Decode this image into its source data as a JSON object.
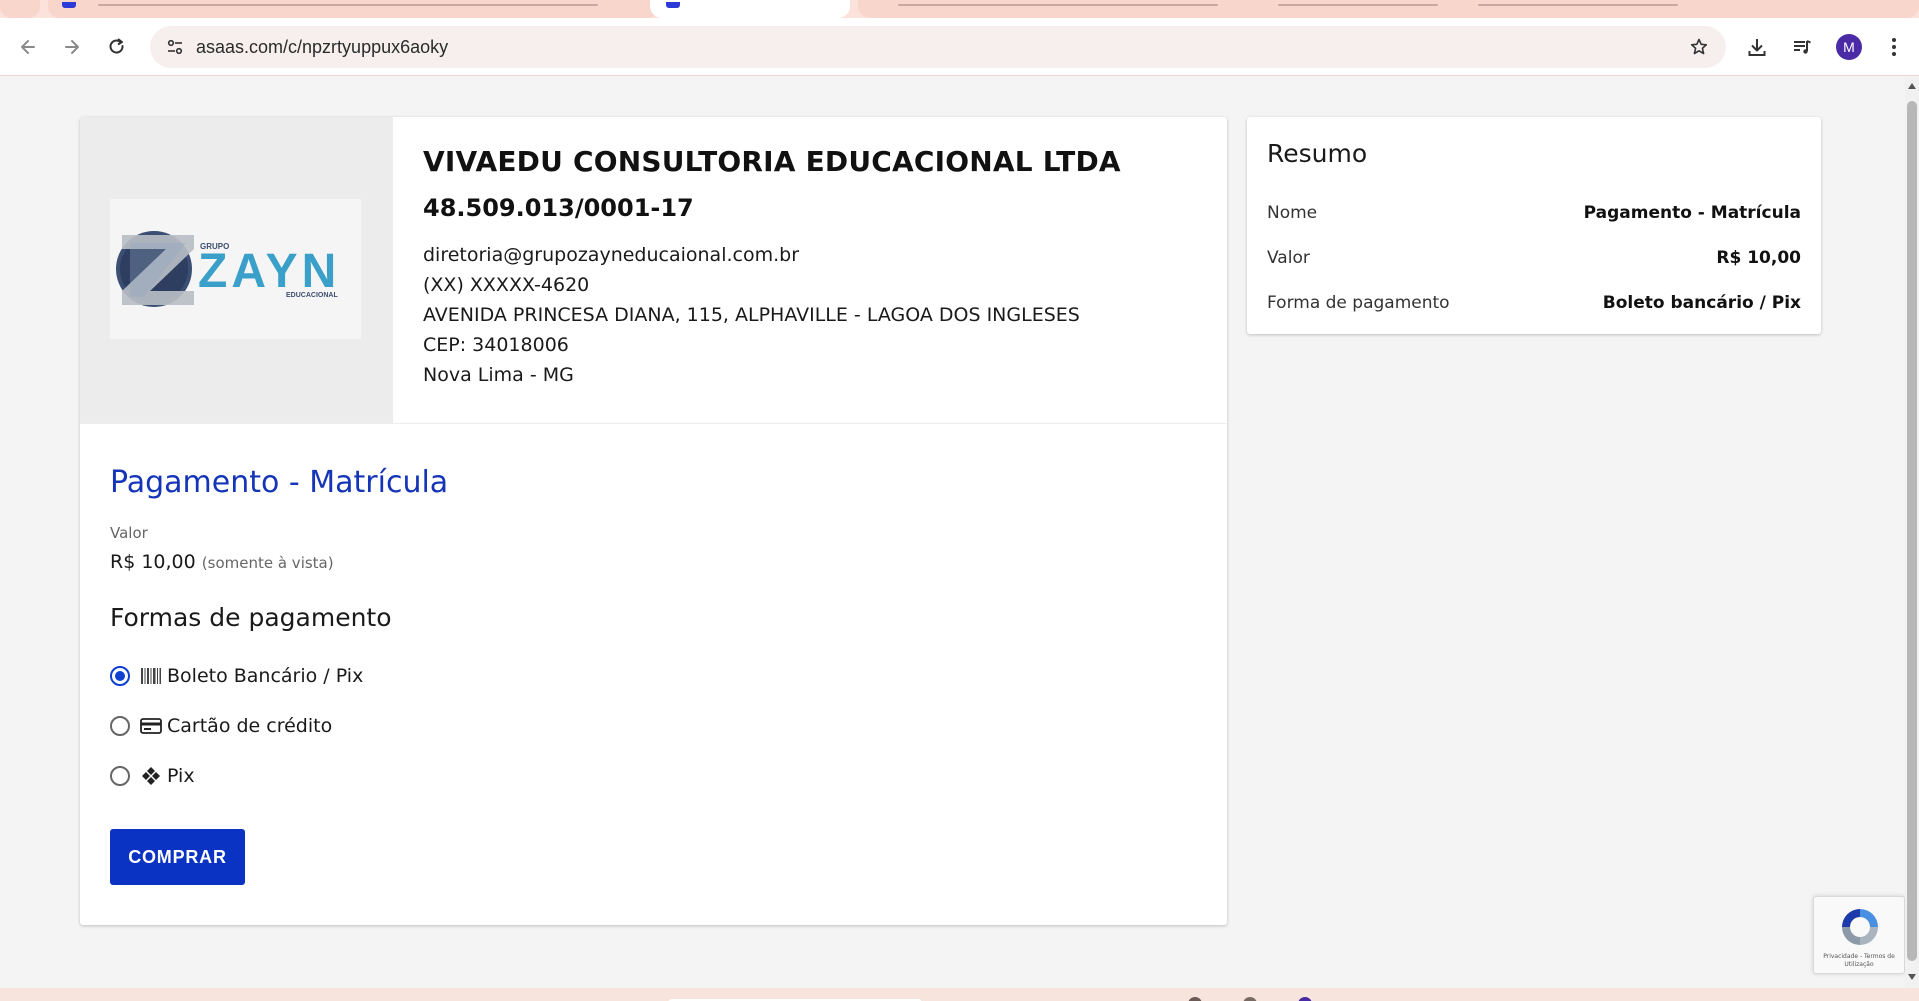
{
  "browser": {
    "url": "asaas.com/c/npzrtyuppux6aoky",
    "profile_initial": "M",
    "icons": [
      "back-icon",
      "forward-icon",
      "reload-icon",
      "site-settings-icon",
      "bookmark-star-icon",
      "download-icon",
      "media-queue-icon",
      "more-menu-icon"
    ]
  },
  "company": {
    "logo_group": "GRUPO",
    "logo_word": "ZAYN",
    "logo_sub": "EDUCACIONAL",
    "name": "VIVAEDU CONSULTORIA EDUCACIONAL LTDA",
    "document": "48.509.013/0001-17",
    "email": "diretoria@grupozayneducaional.com.br",
    "phone": "(XX) XXXXX-4620",
    "address": "AVENIDA PRINCESA DIANA, 115, ALPHAVILLE - LAGOA DOS INGLESES",
    "cep": "CEP: 34018006",
    "city": "Nova Lima - MG"
  },
  "payment": {
    "title": "Pagamento - Matrícula",
    "value_label": "Valor",
    "value": "R$ 10,00",
    "value_note": "(somente à vista)",
    "methods_title": "Formas de pagamento",
    "methods": [
      {
        "label": "Boleto Bancário / Pix",
        "icon": "barcode-icon",
        "selected": true
      },
      {
        "label": "Cartão de crédito",
        "icon": "credit-card-icon",
        "selected": false
      },
      {
        "label": "Pix",
        "icon": "pix-icon",
        "selected": false
      }
    ],
    "buy_label": "COMPRAR"
  },
  "summary": {
    "title": "Resumo",
    "rows": [
      {
        "label": "Nome",
        "value": "Pagamento - Matrícula"
      },
      {
        "label": "Valor",
        "value": "R$ 10,00"
      },
      {
        "label": "Forma de pagamento",
        "value": "Boleto bancário / Pix"
      }
    ]
  },
  "recaptcha": {
    "text": "Privacidade - Termos de Utilização"
  },
  "colors": {
    "primary": "#0a32c3",
    "title_blue": "#1535b8",
    "background": "#f4f4f4"
  }
}
